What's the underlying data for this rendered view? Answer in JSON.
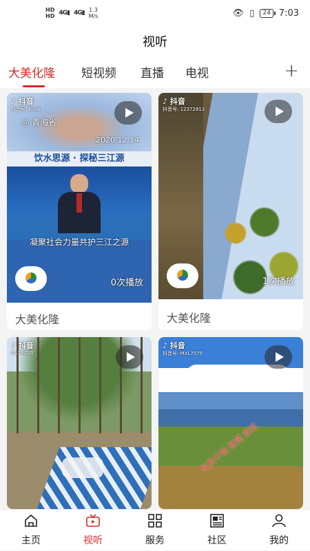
{
  "status_bar": {
    "hd1": "HD",
    "hd2": "HD",
    "signal1": "4G",
    "signal2": "4G",
    "speed_value": "1.3",
    "speed_unit": "M/s",
    "battery": "24",
    "time": "7:03"
  },
  "header": {
    "title": "视听"
  },
  "tabs": [
    {
      "label": "大美化隆"
    },
    {
      "label": "短视频"
    },
    {
      "label": "直播"
    },
    {
      "label": "电视"
    }
  ],
  "cards": [
    {
      "douyin": "抖音",
      "douyin_id": "抖音号: klxst",
      "location": "青海省",
      "date": "2020.12.14",
      "banner": "饮水思源 · 探秘三江源",
      "subtitle": "凝聚社会力量共护三江之源",
      "plays": "0次播放",
      "title": "大美化隆"
    },
    {
      "douyin": "抖音",
      "douyin_id": "抖音号: 12372813",
      "plays": "1次播放",
      "title": "大美化隆"
    },
    {
      "douyin": "抖音",
      "douyin_id": "ID:XE200"
    },
    {
      "douyin": "抖音",
      "douyin_id": "抖音号: MXL7575",
      "overlay_text": "风景不错 就是 就这"
    }
  ],
  "bottom_nav": [
    {
      "label": "主页",
      "icon": "home-icon"
    },
    {
      "label": "视听",
      "icon": "tv-icon"
    },
    {
      "label": "服务",
      "icon": "grid-icon"
    },
    {
      "label": "社区",
      "icon": "news-icon"
    },
    {
      "label": "我的",
      "icon": "person-icon"
    }
  ],
  "colors": {
    "accent": "#d42a24",
    "background": "#f4f4f4"
  }
}
